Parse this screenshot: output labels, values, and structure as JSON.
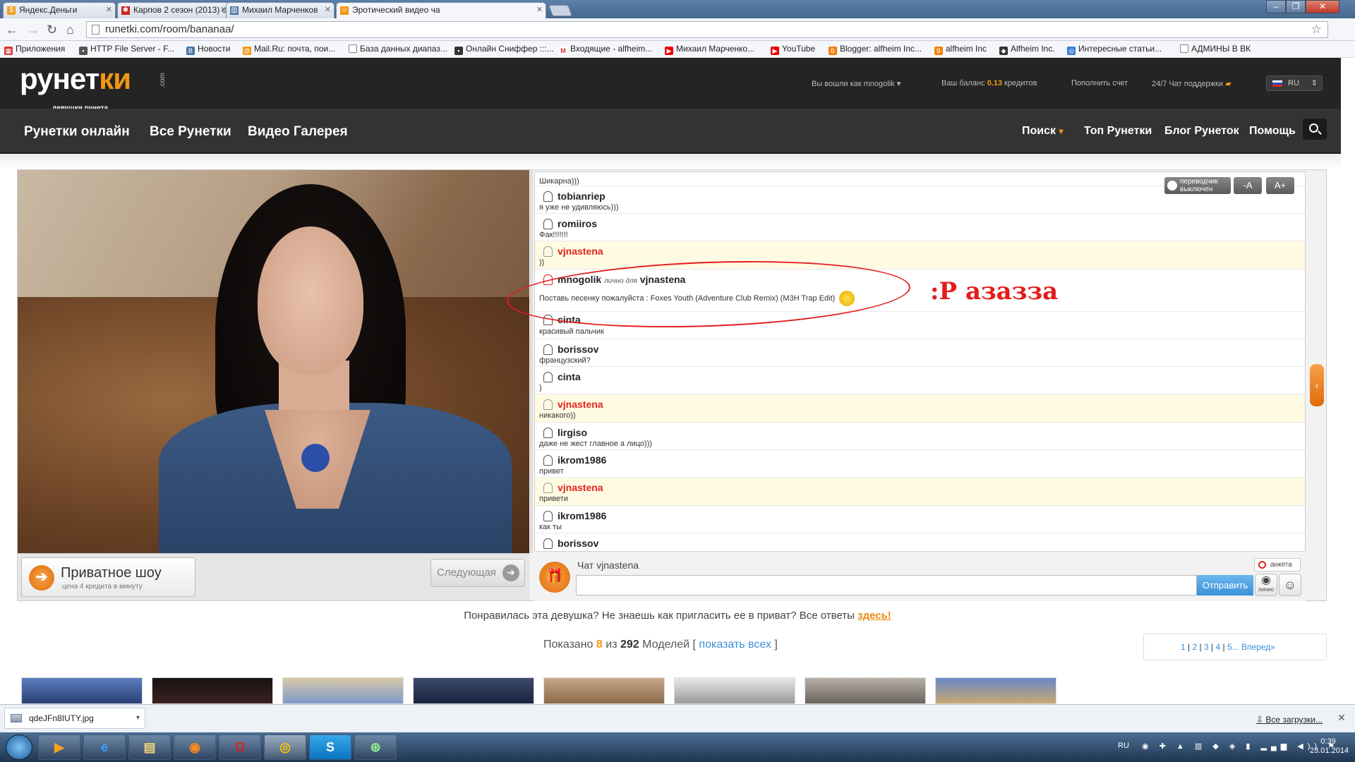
{
  "browser": {
    "tabs": [
      {
        "title": "Яндекс.Деньги",
        "favicon": "yandex-money-icon",
        "color": "#f0a020"
      },
      {
        "title": "Карпов 2 сезон (2013) см",
        "favicon": "film-icon",
        "color": "#cc2222"
      },
      {
        "title": "Михаил Марченков",
        "favicon": "vk-icon",
        "color": "#4a76a8"
      },
      {
        "title": "Эротический видео ча",
        "favicon": "runetki-icon",
        "color": "#f39712"
      }
    ],
    "url": "runetki.com/room/bananaa/",
    "bookmarks": [
      {
        "label": "Приложения",
        "icon": "apps-icon",
        "color": "#d33"
      },
      {
        "label": "HTTP File Server - F...",
        "icon": "server-icon",
        "color": "#555"
      },
      {
        "label": "Новости",
        "icon": "vk-icon",
        "color": "#4a76a8"
      },
      {
        "label": "Mail.Ru: почта, пои...",
        "icon": "mailru-icon",
        "color": "#f39712"
      },
      {
        "label": "База данных диапаз...",
        "icon": "page-icon",
        "color": "#888"
      },
      {
        "label": "Онлайн Сниффер :::...",
        "icon": "floppy-icon",
        "color": "#333"
      },
      {
        "label": "Входящие - alfheim...",
        "icon": "gmail-icon",
        "color": "#d33"
      },
      {
        "label": "Михаил Марченко...",
        "icon": "youtube-icon",
        "color": "#e00"
      },
      {
        "label": "YouTube",
        "icon": "youtube-icon",
        "color": "#e00"
      },
      {
        "label": "Blogger: alfheim Inc...",
        "icon": "blogger-icon",
        "color": "#f57d00"
      },
      {
        "label": "alfheim Inc",
        "icon": "blogger-icon",
        "color": "#f57d00"
      },
      {
        "label": "Alfheim Inc.",
        "icon": "wolf-icon",
        "color": "#333"
      },
      {
        "label": "Интересные статьи...",
        "icon": "globe-icon",
        "color": "#3a7bd5"
      },
      {
        "label": "АДМИНЫ В ВК",
        "icon": "page-icon",
        "color": "#888"
      }
    ]
  },
  "site": {
    "logo_main": "рунет",
    "logo_accent": "ки",
    "logo_com": ".com",
    "logo_sub": "девушки рунета",
    "logged_in": "Вы вошли как mnogolik",
    "balance_label": "Ваш баланс",
    "balance_value": "0.13",
    "balance_unit": "кредитов",
    "topup": "Пополнить счет",
    "support": "24/7 Чат поддержки",
    "lang": "RU",
    "nav_left": [
      "Рунетки онлайн",
      "Все Рунетки",
      "Видео Галерея"
    ],
    "nav_right": [
      "Поиск",
      "Топ Рунетки",
      "Блог Рунеток",
      "Помощь"
    ]
  },
  "video": {
    "private_show": "Приватное шоу",
    "private_price": "цена 4 кредита в минуту",
    "next": "Следующая"
  },
  "chat": {
    "controls": {
      "translator": "переводчик выключен",
      "font_minus": "-A",
      "font_plus": "A+"
    },
    "messages": [
      {
        "user": "",
        "text": "Шикарна)))",
        "host": false
      },
      {
        "user": "tobianriep",
        "text": "я уже не удивляюсь)))",
        "host": false
      },
      {
        "user": "romiiros",
        "text": "Фак!!!!!!!",
        "host": false
      },
      {
        "user": "vjnastena",
        "text": "))",
        "host": true
      },
      {
        "user": "mnogolik",
        "private_label": "лично для",
        "to": "vjnastena",
        "text": "Поставь песенку пожалуйста : Foxes Youth (Adventure Club Remix) (M3H Trap Edit)",
        "host": false
      },
      {
        "user": "cinta",
        "text": "красивый пальчик",
        "host": false
      },
      {
        "user": "borissov",
        "text": "французский?",
        "host": false
      },
      {
        "user": "cinta",
        "text": ")",
        "host": false
      },
      {
        "user": "vjnastena",
        "text": "никакого))",
        "host": true
      },
      {
        "user": "lirgiso",
        "text": "даже не жест главное а лицо)))",
        "host": false
      },
      {
        "user": "ikrom1986",
        "text": "привет",
        "host": false
      },
      {
        "user": "vjnastena",
        "text": "привети",
        "host": true
      },
      {
        "user": "ikrom1986",
        "text": "как ты",
        "host": false
      },
      {
        "user": "borissov",
        "text": "",
        "host": false
      }
    ],
    "annotation": ":Р азазза",
    "chat_with": "Чат vjnastena",
    "anketa": "анкета",
    "send": "Отправить",
    "private_toggle": "лично"
  },
  "below": {
    "promo": "Понравилась эта девушка? Не знаешь как пригласить ее в приват? Все ответы",
    "promo_link": "здесь!",
    "shown_label": "Показано",
    "shown_count": "8",
    "shown_of": "из",
    "shown_total": "292",
    "shown_models": "Моделей",
    "show_all": "показать всех",
    "pages": [
      "1",
      "2",
      "3",
      "4",
      "5..."
    ],
    "next_page": "Вперед»"
  },
  "downloads": {
    "file": "qdeJFn8IUTY.jpg",
    "all": "Все загрузки..."
  },
  "taskbar": {
    "lang": "RU",
    "time": "0:39",
    "date": "23.01.2014"
  }
}
